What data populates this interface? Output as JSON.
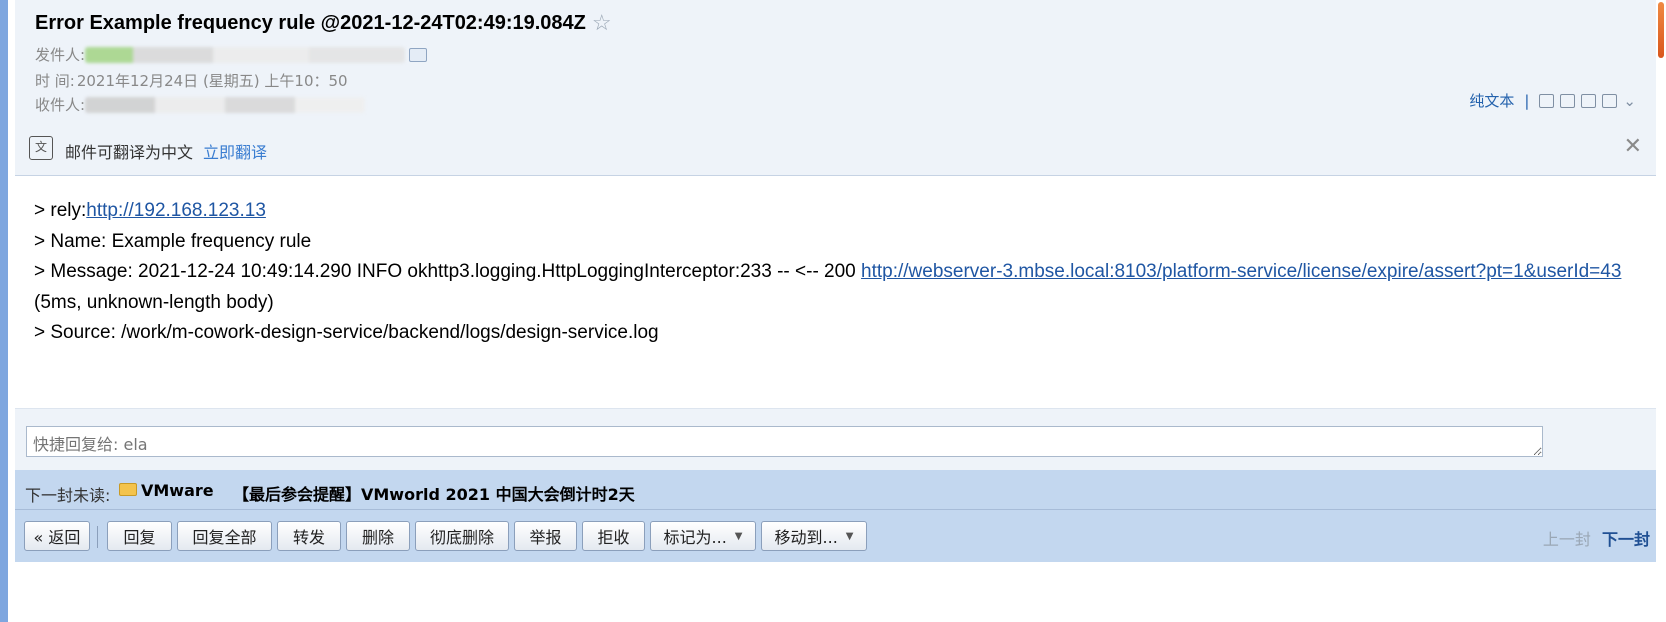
{
  "email": {
    "subject": "Error Example frequency rule @2021-12-24T02:49:19.084Z",
    "sender_label": "发件人:",
    "time_label": "时    间:",
    "time_value": "2021年12月24日 (星期五) 上午10：50",
    "recipient_label": "收件人:"
  },
  "header_tools": {
    "plain_text": "纯文本",
    "separator": "|"
  },
  "translate": {
    "message": "邮件可翻译为中文",
    "action": "立即翻译"
  },
  "body": {
    "line1_prefix": "> rely:",
    "line1_link": "http://192.168.123.13",
    "line2": "> Name: Example frequency rule",
    "line3_prefix": "> Message: 2021-12-24 10:49:14.290  INFO okhttp3.logging.HttpLoggingInterceptor:233 -- <-- 200 ",
    "line3_link": "http://webserver-3.mbse.local:8103/platform-service/license/expire/assert?pt=1&userId=43",
    "line3_suffix": " (5ms, unknown-length body)",
    "line4": "> Source: /work/m-cowork-design-service/backend/logs/design-service.log"
  },
  "quick_reply": {
    "placeholder": "快捷回复给: ela"
  },
  "next_unread": {
    "label": "下一封未读:",
    "sender": "VMware",
    "subject": "【最后参会提醒】VMworld 2021 中国大会倒计时2天"
  },
  "actions": {
    "back": "« 返回",
    "reply": "回复",
    "reply_all": "回复全部",
    "forward": "转发",
    "delete": "删除",
    "delete_permanently": "彻底删除",
    "report": "举报",
    "reject": "拒收",
    "mark_as": "标记为...",
    "move_to": "移动到..."
  },
  "pager": {
    "prev": "上一封",
    "next": "下一封"
  },
  "colors": {
    "header_bg": "#eef3f9",
    "toolbar_bg": "#c3d7ef",
    "link": "#1f56a3",
    "left_strip": "#7ea6df"
  }
}
